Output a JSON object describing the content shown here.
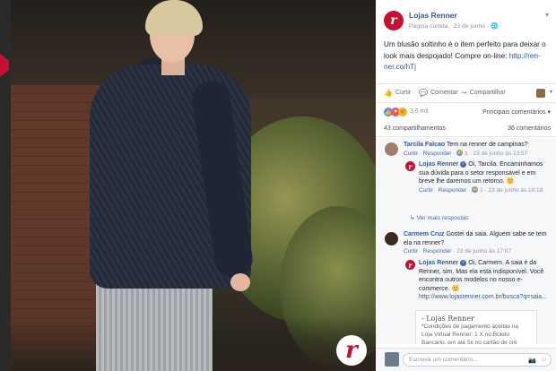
{
  "post": {
    "page_name": "Lojas Renner",
    "meta": "Página curtida · 23 de junho · 🌐",
    "text": "Um blusão soltinho é o item perfeito para deixar o look mais despojado! Compre on-line: ",
    "link": "http://ren-ner.co/hTj",
    "logo_letter": "r"
  },
  "actions": {
    "like": "Curtir",
    "comment": "Comentar",
    "share": "Compartilhar"
  },
  "reactions": {
    "count": "3,6 mil",
    "sort": "Principais comentários ▾"
  },
  "stats": {
    "shares": "43 compartilhamentos",
    "comments": "36 comentários"
  },
  "comments": [
    {
      "name": "Tarcila Falcao",
      "text": "Tem na renner de campinas?",
      "meta_curtir": "Curtir",
      "meta_responder": "Responder",
      "meta_likes": "1",
      "meta_time": "23 de junho às 13:57",
      "reply": {
        "name": "Lojas Renner",
        "text": "Oi, Tarcila. Encaminhamos sua dúvida para o setor responsável e em breve lhe daremos um retorno. 🙂",
        "meta_curtir": "Curtir",
        "meta_responder": "Responder",
        "meta_likes": "1",
        "meta_time": "23 de junho às 18:18"
      },
      "more": "Ver mais respostas"
    },
    {
      "name": "Carmem Cruz",
      "text": "Gostei da saia. Alguem sabe se tem ela na renner?",
      "meta_curtir": "Curtir",
      "meta_responder": "Responder",
      "meta_time": "23 de junho às 17:07",
      "reply": {
        "name": "Lojas Renner",
        "text": "Oi, Carmem. A saia é da Renner, sim. Mas ela está indisponível. Você encontra outros modelos no nosso e-commerce. 🙂",
        "link": "http://www.lojasrenner.com.br/busca?q=saia...",
        "card_title": "- Lojas Renner",
        "card_text": "*Condições de pagamento aceitas na Loja Virtual Renner: 1 X no Boleto Bancário, em até 5x no cartão de cré"
      }
    }
  ],
  "compose": {
    "placeholder": "Escreva um comentário..."
  }
}
